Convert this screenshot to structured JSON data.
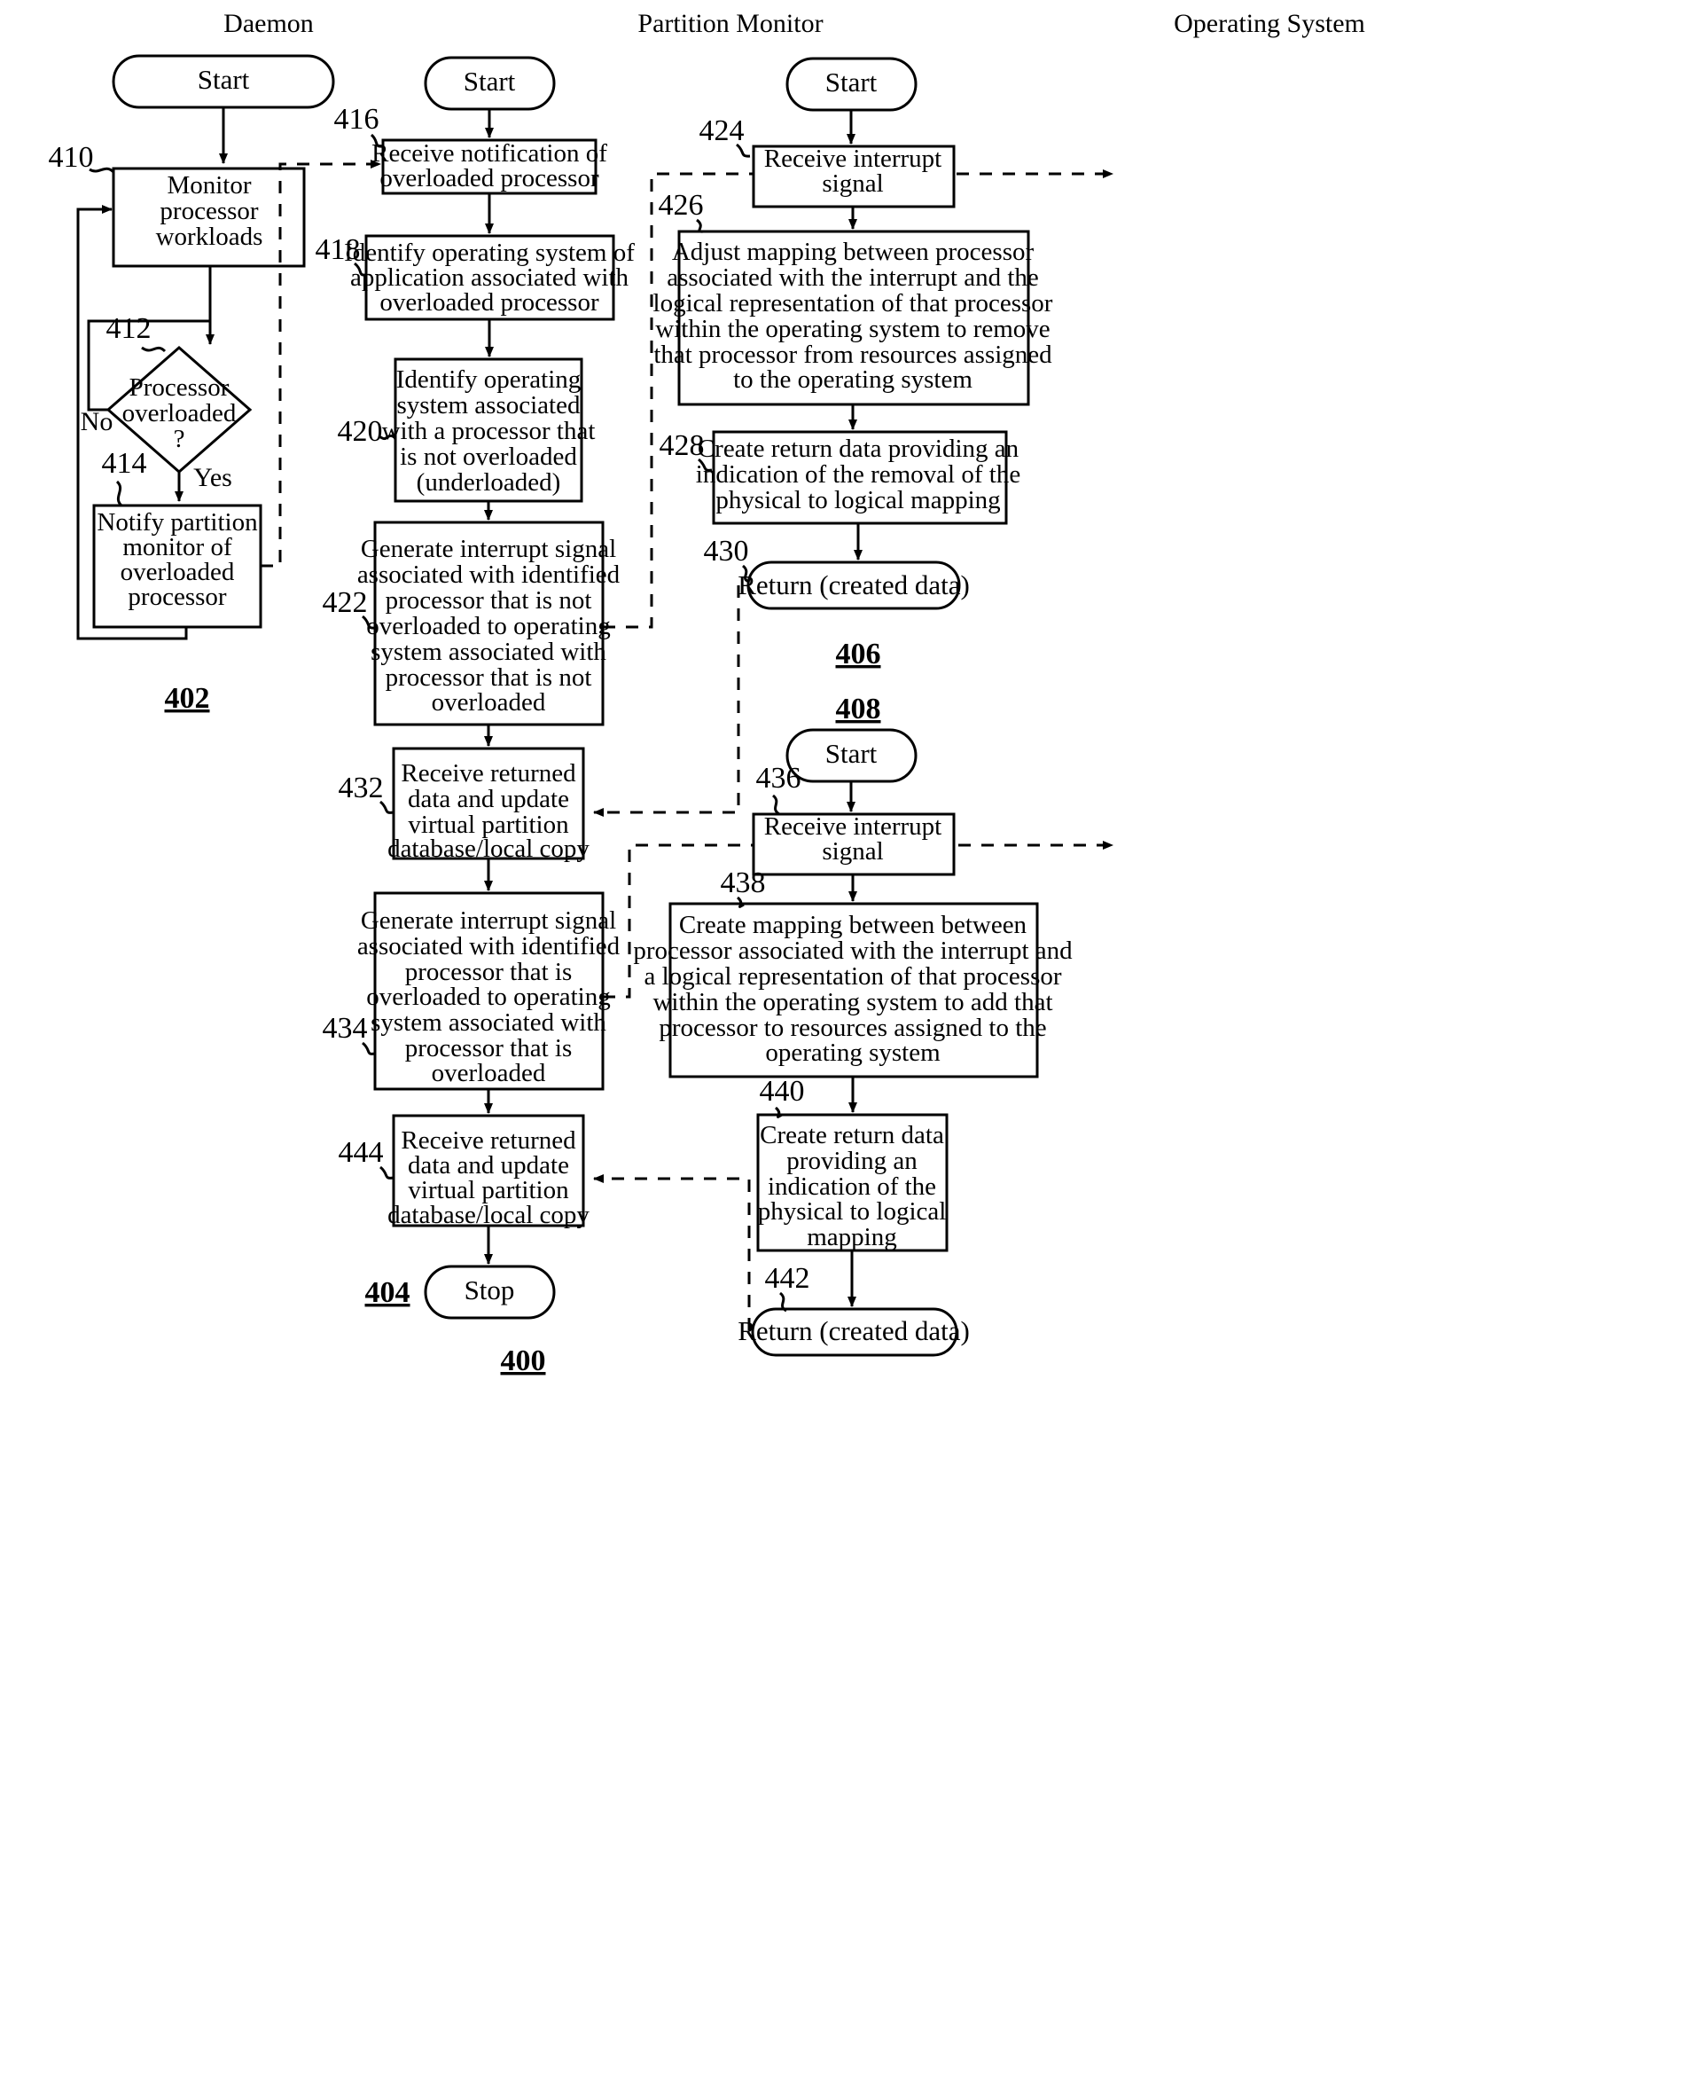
{
  "figure": {
    "number": "400",
    "columns": [
      {
        "id": "daemon",
        "title": "Daemon"
      },
      {
        "id": "partition_monitor",
        "title": "Partition Monitor"
      },
      {
        "id": "operating_system",
        "title": "Operating System"
      }
    ],
    "group_labels": [
      {
        "id": "g402",
        "text": "402"
      },
      {
        "id": "g404",
        "text": "404"
      },
      {
        "id": "g406",
        "text": "406"
      },
      {
        "id": "g408",
        "text": "408"
      },
      {
        "id": "g400",
        "text": "400"
      }
    ]
  },
  "daemon": {
    "start": {
      "ref": "",
      "text": "Start"
    },
    "n410": {
      "ref": "410",
      "lines": [
        "Monitor",
        "processor",
        "workloads"
      ]
    },
    "n412": {
      "ref": "412",
      "lines": [
        "Processor",
        "overloaded",
        "?"
      ],
      "branch_no": "No",
      "branch_yes": "Yes"
    },
    "n414": {
      "ref": "414",
      "lines": [
        "Notify partition",
        "monitor of",
        "overloaded",
        "processor"
      ]
    }
  },
  "partition_monitor": {
    "start": {
      "ref": "",
      "text": "Start"
    },
    "n416": {
      "ref": "416",
      "lines": [
        "Receive notification of",
        "overloaded processor"
      ]
    },
    "n418": {
      "ref": "418",
      "lines": [
        "Identify operating system of",
        "application associated with",
        "overloaded processor"
      ]
    },
    "n420": {
      "ref": "420",
      "lines": [
        "Identify operating",
        "system associated",
        "with a processor that",
        "is not overloaded",
        "(underloaded)"
      ]
    },
    "n422": {
      "ref": "422",
      "lines": [
        "Generate interrupt signal",
        "associated with identified",
        "processor that is not",
        "overloaded to operating",
        "system associated with",
        "processor that is not",
        "overloaded"
      ]
    },
    "n432": {
      "ref": "432",
      "lines": [
        "Receive returned",
        "data and update",
        "virtual partition",
        "database/local copy"
      ]
    },
    "n434": {
      "ref": "434",
      "lines": [
        "Generate interrupt signal",
        "associated with identified",
        "processor that is",
        "overloaded to operating",
        "system associated with",
        "processor that is",
        "overloaded"
      ]
    },
    "n444": {
      "ref": "444",
      "lines": [
        "Receive returned",
        "data and update",
        "virtual partition",
        "database/local copy"
      ]
    },
    "stop": {
      "ref": "",
      "text": "Stop"
    }
  },
  "operating_system": {
    "start_a": {
      "ref": "",
      "text": "Start"
    },
    "n424": {
      "ref": "424",
      "lines": [
        "Receive interrupt",
        "signal"
      ]
    },
    "n426": {
      "ref": "426",
      "lines": [
        "Adjust mapping between processor",
        "associated with the interrupt and the",
        "logical representation of that processor",
        "within the operating system to remove",
        "that processor from resources assigned",
        "to the operating system"
      ]
    },
    "n428": {
      "ref": "428",
      "lines": [
        "Create return data providing an",
        "indication of the removal of the",
        "physical to logical mapping"
      ]
    },
    "n430": {
      "ref": "430",
      "text": "Return (created data)"
    },
    "start_b": {
      "ref": "",
      "text": "Start"
    },
    "n436": {
      "ref": "436",
      "lines": [
        "Receive interrupt",
        "signal"
      ]
    },
    "n438": {
      "ref": "438",
      "lines": [
        "Create mapping between between",
        "processor associated with the interrupt and",
        "a logical representation of that processor",
        "within the operating system to add that",
        "processor to resources assigned to the",
        "operating system"
      ]
    },
    "n440": {
      "ref": "440",
      "lines": [
        "Create return data",
        "providing an",
        "indication of the",
        "physical to logical",
        "mapping"
      ]
    },
    "n442": {
      "ref": "442",
      "text": "Return (created data)"
    }
  }
}
